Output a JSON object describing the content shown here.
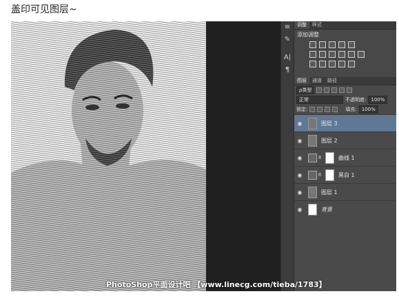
{
  "caption": "盖印可见图层~",
  "adjustments": {
    "tabs": [
      "调整",
      "样式"
    ],
    "title": "添加调整"
  },
  "layers_panel": {
    "tabs": [
      "图层",
      "通道",
      "路径"
    ],
    "filter_label": "ρ类型",
    "blend_mode": "正常",
    "opacity_label": "不透明度:",
    "opacity_value": "100%",
    "lock_label": "锁定:",
    "fill_label": "填充:",
    "fill_value": "100%",
    "layers": [
      {
        "name": "图层 3",
        "selected": true
      },
      {
        "name": "图层 2",
        "selected": false
      },
      {
        "name": "曲线 1",
        "selected": false
      },
      {
        "name": "黑白 1",
        "selected": false
      },
      {
        "name": "图层 1",
        "selected": false
      },
      {
        "name": "背景",
        "selected": false
      }
    ]
  },
  "watermark": "PhotoShop平面设计吧 【www.linecg.com/tieba/1783】",
  "colors": {
    "selected_layer": "#5f7896",
    "panel_bg": "#484848"
  }
}
